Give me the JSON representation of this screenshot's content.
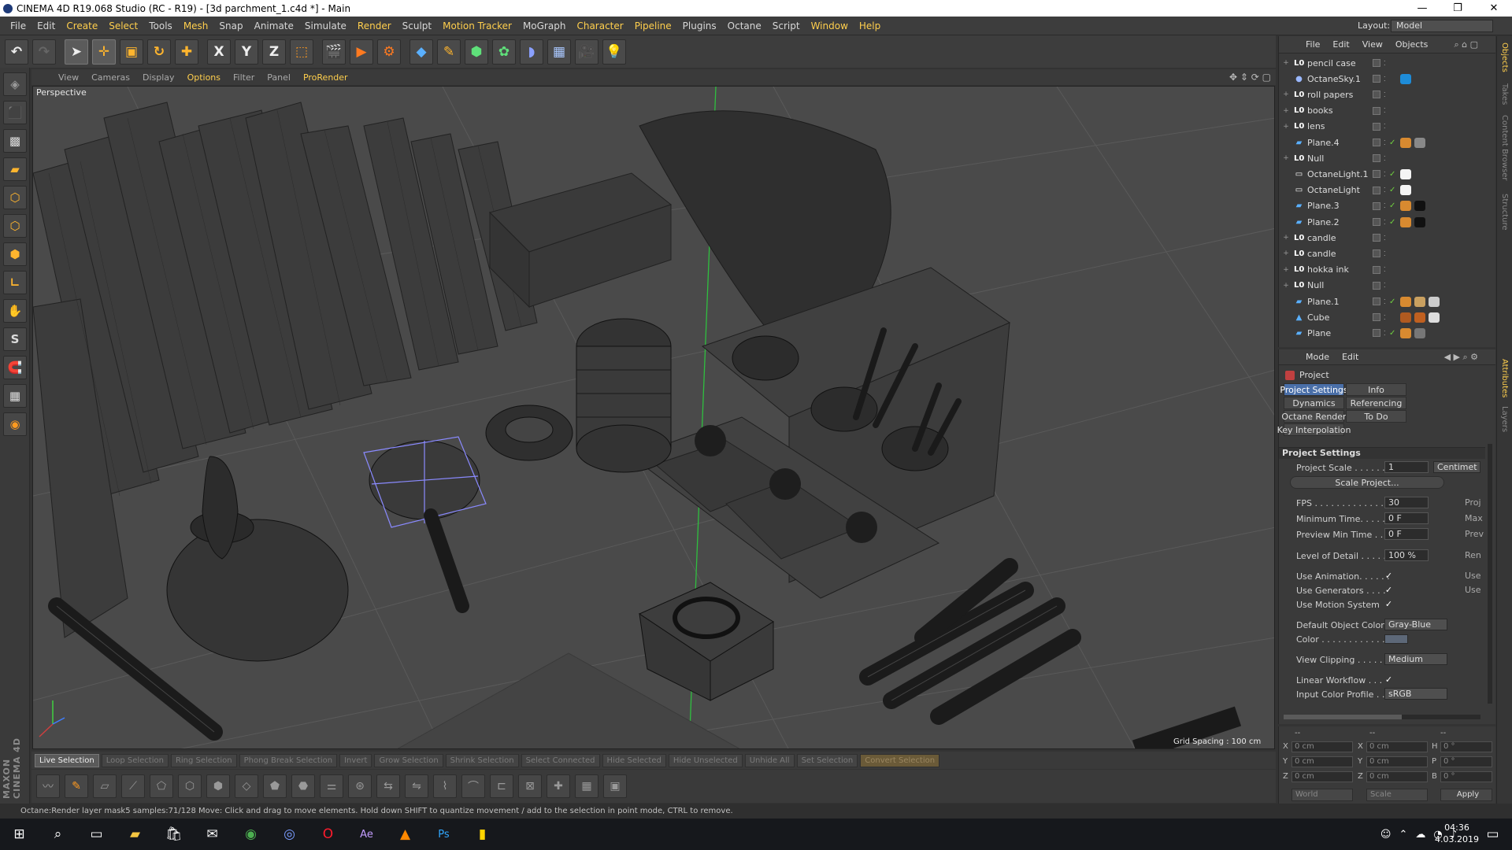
{
  "window": {
    "title": "CINEMA 4D R19.068 Studio (RC - R19) - [3d parchment_1.c4d *] - Main",
    "min": "—",
    "max": "❐",
    "close": "✕"
  },
  "menu": [
    "File",
    "Edit",
    "Create",
    "Select",
    "Tools",
    "Mesh",
    "Snap",
    "Animate",
    "Simulate",
    "Render",
    "Sculpt",
    "Motion Tracker",
    "MoGraph",
    "Character",
    "Pipeline",
    "Plugins",
    "Octane",
    "Script",
    "Window",
    "Help"
  ],
  "layout": {
    "label": "Layout:",
    "value": "Model"
  },
  "toolbar_axes": [
    "X",
    "Y",
    "Z"
  ],
  "viewport": {
    "menu": [
      "View",
      "Cameras",
      "Display",
      "Options",
      "Filter",
      "Panel",
      "ProRender"
    ],
    "label": "Perspective",
    "grid_spacing": "Grid Spacing : 100 cm"
  },
  "bottom_buttons": [
    "Live Selection",
    "Loop Selection",
    "Ring Selection",
    "Phong Break Selection",
    "Invert",
    "Grow Selection",
    "Shrink Selection",
    "Select Connected",
    "Hide Selected",
    "Hide Unselected",
    "Unhide All",
    "Set Selection",
    "Convert Selection"
  ],
  "status": "Octane:Render layer mask5 samples:71/128     Move: Click and drag to move elements. Hold down SHIFT to quantize movement / add to the selection in point mode, CTRL to remove.",
  "objects": {
    "menu": [
      "File",
      "Edit",
      "View",
      "Objects"
    ],
    "rows": [
      {
        "name": "pencil case",
        "icon": "null-icon",
        "expand": "+"
      },
      {
        "name": "OctaneSky.1",
        "icon": "sky-icon",
        "expand": ""
      },
      {
        "name": "roll papers",
        "icon": "null-icon",
        "expand": "+"
      },
      {
        "name": "books",
        "icon": "null-icon",
        "expand": "+"
      },
      {
        "name": "lens",
        "icon": "null-icon",
        "expand": "+"
      },
      {
        "name": "Plane.4",
        "icon": "plane-icon",
        "expand": ""
      },
      {
        "name": "Null",
        "icon": "null-icon",
        "expand": "+"
      },
      {
        "name": "OctaneLight.1",
        "icon": "light-icon",
        "expand": ""
      },
      {
        "name": "OctaneLight",
        "icon": "light-icon",
        "expand": ""
      },
      {
        "name": "Plane.3",
        "icon": "plane-icon",
        "expand": ""
      },
      {
        "name": "Plane.2",
        "icon": "plane-icon",
        "expand": ""
      },
      {
        "name": "candle",
        "icon": "null-icon",
        "expand": "+"
      },
      {
        "name": "candle",
        "icon": "null-icon",
        "expand": "+"
      },
      {
        "name": "hokka ink",
        "icon": "null-icon",
        "expand": "+"
      },
      {
        "name": "Null",
        "icon": "null-icon",
        "expand": "+"
      },
      {
        "name": "Plane.1",
        "icon": "plane-icon",
        "expand": ""
      },
      {
        "name": "Cube",
        "icon": "cube-icon",
        "expand": ""
      },
      {
        "name": "Plane",
        "icon": "plane-icon",
        "expand": ""
      }
    ]
  },
  "attributes": {
    "menu": [
      "Mode",
      "Edit"
    ],
    "title": "Project",
    "tabs": [
      "Project Settings",
      "Info",
      "Dynamics",
      "Referencing",
      "Octane Render",
      "To Do",
      "Key Interpolation"
    ],
    "section": "Project Settings",
    "project_scale": {
      "label": "Project Scale . . . . . . .",
      "value": "1",
      "unit": "Centimet"
    },
    "scale_button": "Scale Project...",
    "fps": {
      "label": "FPS . . . . . . . . . . . . . .",
      "value": "30",
      "right": "Proj"
    },
    "min_time": {
      "label": "Minimum Time. . . . . .",
      "value": "0 F",
      "right": "Max"
    },
    "preview_min": {
      "label": "Preview Min Time . . .",
      "value": "0 F",
      "right": "Prev"
    },
    "lod": {
      "label": "Level of Detail . . . . .",
      "value": "100 %",
      "right": "Ren"
    },
    "use_animation": {
      "label": "Use Animation. . . . . .",
      "right": "Use"
    },
    "use_generators": {
      "label": "Use Generators . . . .",
      "right": "Use"
    },
    "use_motion": {
      "label": "Use Motion System"
    },
    "default_color": {
      "label": "Default Object Color",
      "value": "Gray-Blue"
    },
    "color": {
      "label": "Color . . . . . . . . . . . ."
    },
    "view_clipping": {
      "label": "View Clipping . . . . .",
      "value": "Medium"
    },
    "linear_workflow": {
      "label": "Linear Workflow . . ."
    },
    "input_profile": {
      "label": "Input Color Profile . .",
      "value": "sRGB"
    },
    "check": "✓"
  },
  "coords": {
    "headers": [
      "--",
      "--",
      "--"
    ],
    "rows": [
      {
        "a": "X",
        "av": "0 cm",
        "b": "X",
        "bv": "0 cm",
        "c": "H",
        "cv": "0 °"
      },
      {
        "a": "Y",
        "av": "0 cm",
        "b": "Y",
        "bv": "0 cm",
        "c": "P",
        "cv": "0 °"
      },
      {
        "a": "Z",
        "av": "0 cm",
        "b": "Z",
        "bv": "0 cm",
        "c": "B",
        "cv": "0 °"
      }
    ],
    "world": "World",
    "scale": "Scale",
    "apply": "Apply"
  },
  "right_tabs": [
    "Objects",
    "Takes",
    "Content Browser",
    "Structure",
    "Attributes",
    "Layers"
  ],
  "taskbar": {
    "time": "04:36",
    "date": "4.03.2019"
  },
  "colors": {
    "accent": "#ffcf4d",
    "selection": "#4a6fa8",
    "viewport_bg": "#4a4a4a"
  }
}
